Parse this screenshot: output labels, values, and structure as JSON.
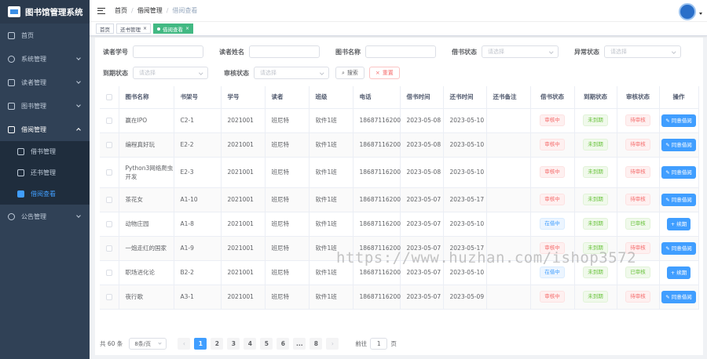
{
  "app": {
    "title": "图书馆管理系统"
  },
  "sidebar": {
    "items": [
      {
        "label": "首页",
        "icon": "dashboard-icon"
      },
      {
        "label": "系统管理",
        "icon": "gear-icon"
      },
      {
        "label": "读者管理",
        "icon": "reader-card-icon"
      },
      {
        "label": "图书管理",
        "icon": "books-icon"
      },
      {
        "label": "借阅管理",
        "icon": "borrow-icon"
      },
      {
        "label": "公告管理",
        "icon": "notice-icon"
      }
    ],
    "sub": [
      "借书管理",
      "还书管理",
      "借阅查看"
    ]
  },
  "breadcrumb": [
    "首页",
    "借阅管理",
    "借阅查看"
  ],
  "tags": [
    "首页",
    "还书管理",
    "借阅查看"
  ],
  "filters": {
    "reader_id": "读者学号",
    "reader_name": "读者姓名",
    "book_name": "图书名称",
    "borrow_status": "借书状态",
    "abnormal_status": "异常状态",
    "due_status": "到期状态",
    "review_status": "审核状态",
    "select_placeholder": "请选择",
    "search": "搜索",
    "reset": "重置"
  },
  "table": {
    "headers": [
      "图书名称",
      "书架号",
      "学号",
      "读者",
      "班级",
      "电话",
      "借书时间",
      "还书时间",
      "还书备注",
      "借书状态",
      "到期状态",
      "审核状态",
      "操作"
    ],
    "rows": [
      {
        "book": "赢在IPO",
        "shelf": "C2-1",
        "sid": "2021001",
        "reader": "班尼特",
        "cls": "软件1班",
        "phone": "18687116200",
        "borrow": "2023-05-08",
        "ret": "2023-05-10",
        "note": "",
        "bs": "审核中",
        "ds": "未到期",
        "rs": "待审核",
        "op": "✎ 同意借阅"
      },
      {
        "book": "编程真好玩",
        "shelf": "E2-2",
        "sid": "2021001",
        "reader": "班尼特",
        "cls": "软件1班",
        "phone": "18687116200",
        "borrow": "2023-05-08",
        "ret": "2023-05-10",
        "note": "",
        "bs": "审核中",
        "ds": "未到期",
        "rs": "待审核",
        "op": "✎ 同意借阅"
      },
      {
        "book": "Python3网络爬虫开发",
        "shelf": "E2-3",
        "sid": "2021001",
        "reader": "班尼特",
        "cls": "软件1班",
        "phone": "18687116200",
        "borrow": "2023-05-08",
        "ret": "2023-05-10",
        "note": "",
        "bs": "审核中",
        "ds": "未到期",
        "rs": "待审核",
        "op": "✎ 同意借阅"
      },
      {
        "book": "茶花女",
        "shelf": "A1-10",
        "sid": "2021001",
        "reader": "班尼特",
        "cls": "软件1班",
        "phone": "18687116200",
        "borrow": "2023-05-07",
        "ret": "2023-05-17",
        "note": "",
        "bs": "审核中",
        "ds": "未到期",
        "rs": "待审核",
        "op": "✎ 同意借阅"
      },
      {
        "book": "动物庄园",
        "shelf": "A1-8",
        "sid": "2021001",
        "reader": "班尼特",
        "cls": "软件1班",
        "phone": "18687116200",
        "borrow": "2023-05-07",
        "ret": "2023-05-10",
        "note": "",
        "bs": "在借中",
        "ds": "未到期",
        "rs": "已审核",
        "op": "+ 续期"
      },
      {
        "book": "一炮走红的国家",
        "shelf": "A1-9",
        "sid": "2021001",
        "reader": "班尼特",
        "cls": "软件1班",
        "phone": "18687116200",
        "borrow": "2023-05-07",
        "ret": "2023-05-17",
        "note": "",
        "bs": "审核中",
        "ds": "未到期",
        "rs": "待审核",
        "op": "✎ 同意借阅"
      },
      {
        "book": "职场进化论",
        "shelf": "B2-2",
        "sid": "2021001",
        "reader": "班尼特",
        "cls": "软件1班",
        "phone": "18687116200",
        "borrow": "2023-05-07",
        "ret": "2023-05-10",
        "note": "",
        "bs": "在借中",
        "ds": "未到期",
        "rs": "已审核",
        "op": "+ 续期"
      },
      {
        "book": "夜行歌",
        "shelf": "A3-1",
        "sid": "2021001",
        "reader": "班尼特",
        "cls": "软件1班",
        "phone": "18687116200",
        "borrow": "2023-05-07",
        "ret": "2023-05-09",
        "note": "",
        "bs": "审核中",
        "ds": "未到期",
        "rs": "待审核",
        "op": "✎ 同意借阅"
      }
    ]
  },
  "pager": {
    "total": "共 60 条",
    "size": "8条/页",
    "pages": [
      "1",
      "2",
      "3",
      "4",
      "5",
      "6",
      "...",
      "8"
    ],
    "prev": "‹",
    "next": "›",
    "goto_label": "前往",
    "goto_value": "1",
    "goto_unit": "页"
  },
  "watermark": "https://www.huzhan.com/ishop3572",
  "colors": {
    "accent": "#409eff",
    "sidebar": "#304156",
    "success": "#42b983",
    "danger": "#f56c6c"
  }
}
